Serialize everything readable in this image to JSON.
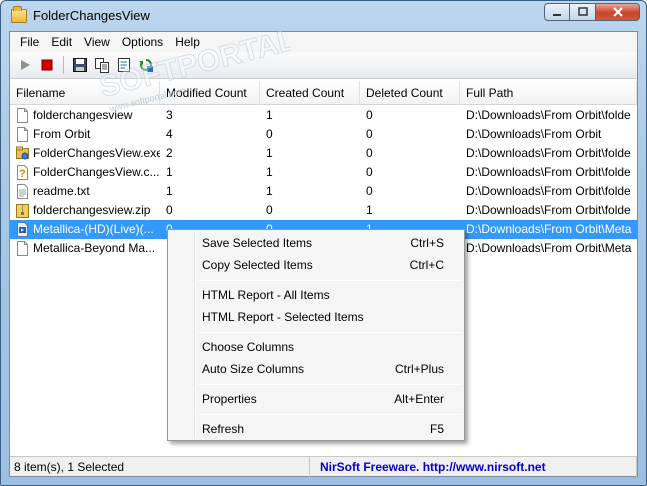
{
  "window": {
    "title": "FolderChangesView"
  },
  "menu": [
    "File",
    "Edit",
    "View",
    "Options",
    "Help"
  ],
  "toolbar": {
    "icons": [
      "play-icon",
      "stop-icon",
      "save-icon",
      "copy-icon",
      "properties-icon",
      "refresh-icon"
    ]
  },
  "columns": [
    "Filename",
    "Modified Count",
    "Created Count",
    "Deleted Count",
    "Full Path"
  ],
  "rows": [
    {
      "filename": "folderchangesview",
      "modified": "3",
      "created": "1",
      "deleted": "0",
      "path": "D:\\Downloads\\From Orbit\\folde",
      "icon": "document-icon"
    },
    {
      "filename": "From Orbit",
      "modified": "4",
      "created": "0",
      "deleted": "0",
      "path": "D:\\Downloads\\From Orbit",
      "icon": "document-icon"
    },
    {
      "filename": "FolderChangesView.exe",
      "modified": "2",
      "created": "1",
      "deleted": "0",
      "path": "D:\\Downloads\\From Orbit\\folde",
      "icon": "exe-icon"
    },
    {
      "filename": "FolderChangesView.c...",
      "modified": "1",
      "created": "1",
      "deleted": "0",
      "path": "D:\\Downloads\\From Orbit\\folde",
      "icon": "help-file-icon"
    },
    {
      "filename": "readme.txt",
      "modified": "1",
      "created": "1",
      "deleted": "0",
      "path": "D:\\Downloads\\From Orbit\\folde",
      "icon": "text-file-icon"
    },
    {
      "filename": "folderchangesview.zip",
      "modified": "0",
      "created": "0",
      "deleted": "1",
      "path": "D:\\Downloads\\From Orbit\\folde",
      "icon": "zip-icon"
    },
    {
      "filename": "Metallica-(HD)(Live)(...",
      "modified": "0",
      "created": "0",
      "deleted": "1",
      "path": "D:\\Downloads\\From Orbit\\Meta",
      "icon": "video-file-icon",
      "selected": true
    },
    {
      "filename": "Metallica-Beyond Ma...",
      "modified": "",
      "created": "",
      "deleted": "",
      "path": "D:\\Downloads\\From Orbit\\Meta",
      "icon": "document-icon"
    }
  ],
  "context_menu": {
    "items": [
      {
        "label": "Save Selected Items",
        "shortcut": "Ctrl+S"
      },
      {
        "label": "Copy Selected Items",
        "shortcut": "Ctrl+C"
      },
      {
        "label": "HTML Report - All Items",
        "shortcut": ""
      },
      {
        "label": "HTML Report - Selected Items",
        "shortcut": ""
      },
      {
        "label": "Choose Columns",
        "shortcut": ""
      },
      {
        "label": "Auto Size Columns",
        "shortcut": "Ctrl+Plus"
      },
      {
        "label": "Properties",
        "shortcut": "Alt+Enter"
      },
      {
        "label": "Refresh",
        "shortcut": "F5"
      }
    ]
  },
  "status": {
    "count": "8 item(s), 1 Selected",
    "link": "NirSoft Freeware.  http://www.nirsoft.net"
  },
  "colors": {
    "selection": "#3399ff",
    "link": "#0000cc",
    "stop": "#d40000",
    "play": "#909090"
  }
}
